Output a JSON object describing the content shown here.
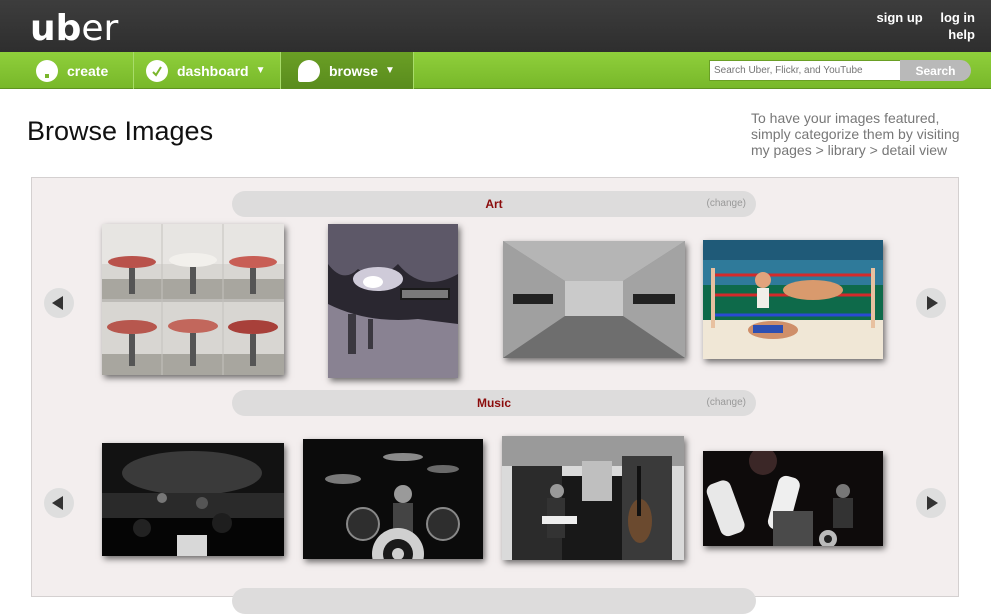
{
  "header": {
    "logo": {
      "prefix": "ub",
      "suffix": "er"
    },
    "links": {
      "signup": "sign up",
      "login": "log in",
      "help": "help"
    }
  },
  "nav": {
    "create": "create",
    "dashboard": "dashboard",
    "browse": "browse",
    "search_placeholder": "Search Uber, Flickr, and YouTube",
    "search_button": "Search"
  },
  "page": {
    "title": "Browse Images",
    "feature_note": "To have your images featured, simply categorize them by visiting my pages > library > detail view"
  },
  "categories": [
    {
      "name": "Art",
      "change": "(change)"
    },
    {
      "name": "Music",
      "change": "(change)"
    }
  ],
  "colors": {
    "nav_green": "#86c434",
    "category_label": "#8b0b0b",
    "header_dark": "#363636"
  }
}
